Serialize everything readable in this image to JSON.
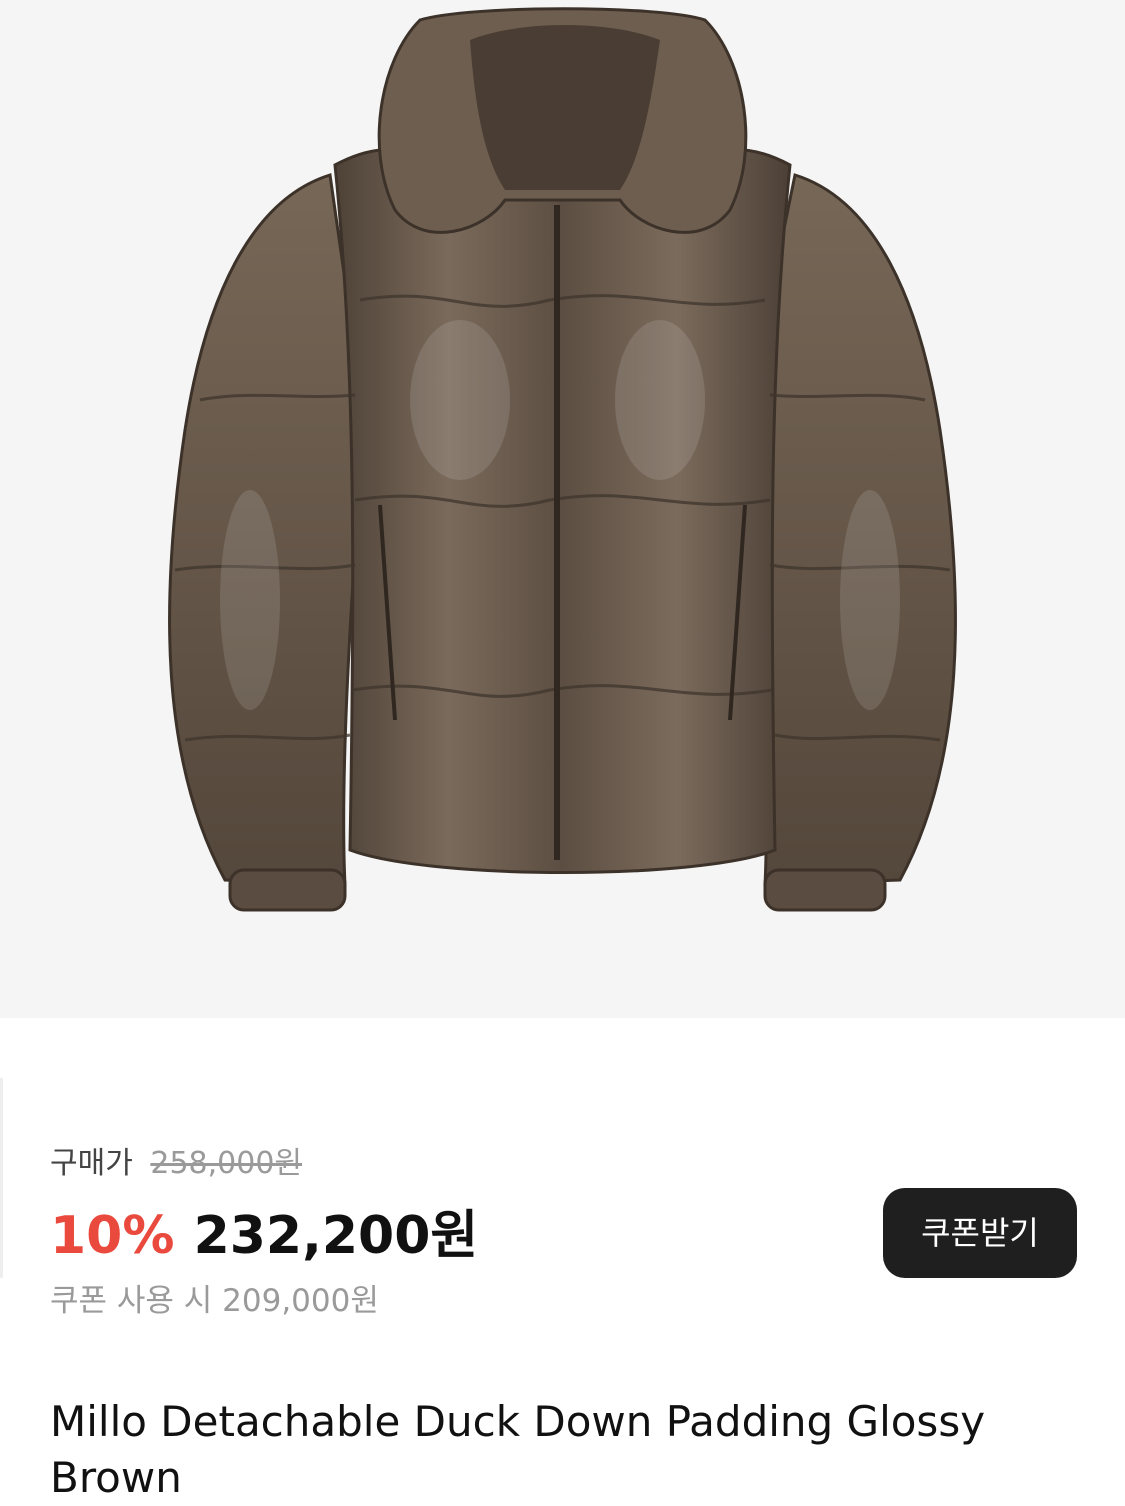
{
  "product": {
    "image_alt": "Brown glossy hooded down padding jacket",
    "purchase_label": "구매가",
    "original_price": "258,000원",
    "discount_rate": "10%",
    "sale_price": "232,200원",
    "coupon_price_text": "쿠폰 사용 시 209,000원",
    "coupon_button_label": "쿠폰받기",
    "title": "Millo Detachable Duck Down Padding Glossy Brown"
  },
  "colors": {
    "discount": "#ea4a3d",
    "button_bg": "#1f1f1f",
    "image_bg": "#f5f5f5",
    "jacket": "#6a5a4c"
  }
}
